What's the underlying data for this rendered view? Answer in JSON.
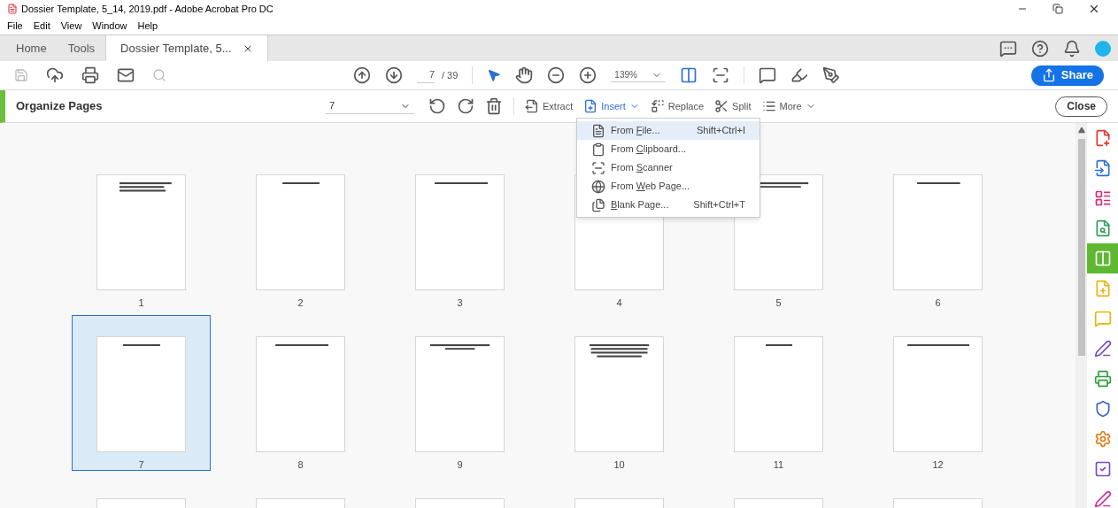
{
  "window": {
    "title": "Dossier Template, 5_14, 2019.pdf - Adobe Acrobat Pro DC"
  },
  "menu": [
    "File",
    "Edit",
    "View",
    "Window",
    "Help"
  ],
  "tabs": [
    {
      "label": "Home",
      "selected": false,
      "closable": false
    },
    {
      "label": "Tools",
      "selected": false,
      "closable": false
    },
    {
      "label": "Dossier Template, 5...",
      "selected": true,
      "closable": true
    }
  ],
  "toolbar": {
    "page": "7",
    "page_count": "/ 39",
    "zoom": "139%",
    "share": "Share"
  },
  "organize": {
    "title": "Organize Pages",
    "page_field": "7",
    "tools": [
      {
        "label": "Extract",
        "kind": "extract",
        "menu": false,
        "active": false
      },
      {
        "label": "Insert",
        "kind": "insert",
        "menu": true,
        "active": true
      },
      {
        "label": "Replace",
        "kind": "replace",
        "menu": false,
        "active": false
      },
      {
        "label": "Split",
        "kind": "split",
        "menu": false,
        "active": false
      },
      {
        "label": "More",
        "kind": "more",
        "menu": true,
        "active": false
      }
    ],
    "close": "Close"
  },
  "insert_menu": [
    {
      "kind": "file",
      "before": "From ",
      "key": "F",
      "after": "ile...",
      "shortcut": "Shift+Ctrl+I",
      "selected": true
    },
    {
      "kind": "clipboard",
      "before": "From ",
      "key": "C",
      "after": "lipboard...",
      "selected": false
    },
    {
      "kind": "scanner",
      "before": "From ",
      "key": "S",
      "after": "canner",
      "selected": false
    },
    {
      "kind": "web",
      "before": "From ",
      "key": "W",
      "after": "eb Page...",
      "selected": false
    },
    {
      "kind": "blank",
      "key": "B",
      "after": "lank Page...",
      "shortcut": "Shift+Ctrl+T",
      "selected": false
    }
  ],
  "pages": [
    {
      "label": "1",
      "selected": false
    },
    {
      "label": "2",
      "selected": false
    },
    {
      "label": "3",
      "selected": false
    },
    {
      "label": "4",
      "selected": false
    },
    {
      "label": "5",
      "selected": false
    },
    {
      "label": "6",
      "selected": false
    },
    {
      "label": "7",
      "selected": true
    },
    {
      "label": "8",
      "selected": false
    },
    {
      "label": "9",
      "selected": false
    },
    {
      "label": "10",
      "selected": false
    },
    {
      "label": "11",
      "selected": false
    },
    {
      "label": "12",
      "selected": false
    },
    {
      "selected": false
    },
    {
      "selected": false
    },
    {
      "selected": false
    },
    {
      "selected": false
    },
    {
      "selected": false
    },
    {
      "selected": false
    }
  ],
  "tool_rail": [
    {
      "kind": "create",
      "color": "#e0362c",
      "selected": false
    },
    {
      "kind": "combine",
      "color": "#2d6fd1",
      "selected": false
    },
    {
      "kind": "organize-list",
      "color": "#d9297a",
      "selected": false
    },
    {
      "kind": "export",
      "color": "#2e9e5b",
      "selected": false
    },
    {
      "kind": "organize",
      "color": "#5fb832",
      "selected": true
    },
    {
      "kind": "edit",
      "color": "#e8b312",
      "selected": false
    },
    {
      "kind": "comment",
      "color": "#e8b312",
      "selected": false
    },
    {
      "kind": "sign",
      "color": "#7a4bc9",
      "selected": false
    },
    {
      "kind": "print",
      "color": "#2e9e3a",
      "selected": false
    },
    {
      "kind": "protect",
      "color": "#3b5fc9",
      "selected": false
    },
    {
      "kind": "optimize",
      "color": "#e07b12",
      "selected": false
    },
    {
      "kind": "form",
      "color": "#7a4bc9",
      "selected": false
    },
    {
      "kind": "fill",
      "color": "#d1309a",
      "selected": false
    }
  ]
}
